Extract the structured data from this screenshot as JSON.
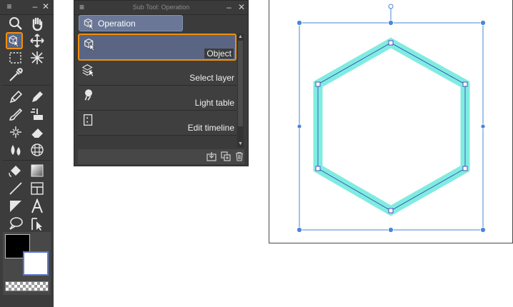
{
  "tool_palette": {
    "tools": [
      "magnifier-tool",
      "hand-tool",
      "operation-tool",
      "move-layer-tool",
      "selection-tool",
      "auto-select-tool",
      "eyedropper-tool",
      "pen-tool",
      "pencil-tool",
      "brush-tool",
      "decoration-tool",
      "airbrush-tool",
      "eraser-tool",
      "blend-tool",
      "perspective-ruler-tool",
      "fill-tool",
      "gradient-tool",
      "figure-tool",
      "frame-border-tool",
      "ruler-tool",
      "text-tool",
      "balloon-tool",
      "correct-line-tool"
    ],
    "main_color": "#000000",
    "sub_color": "#ffffff",
    "active_highlight": "#f0900c"
  },
  "subtool_panel": {
    "title": "Sub Tool: Operation",
    "group_tab": "Operation",
    "items": [
      {
        "label": "Object",
        "icon": "object-icon",
        "selected": true
      },
      {
        "label": "Select layer",
        "icon": "select-layer-icon",
        "selected": false
      },
      {
        "label": "Light table",
        "icon": "light-table-icon",
        "selected": false
      },
      {
        "label": "Edit timeline",
        "icon": "edit-timeline-icon",
        "selected": false
      }
    ]
  },
  "canvas": {
    "shape": "hexagon",
    "stroke_color": "#80ece0",
    "handle_color": "#4a86d8"
  }
}
